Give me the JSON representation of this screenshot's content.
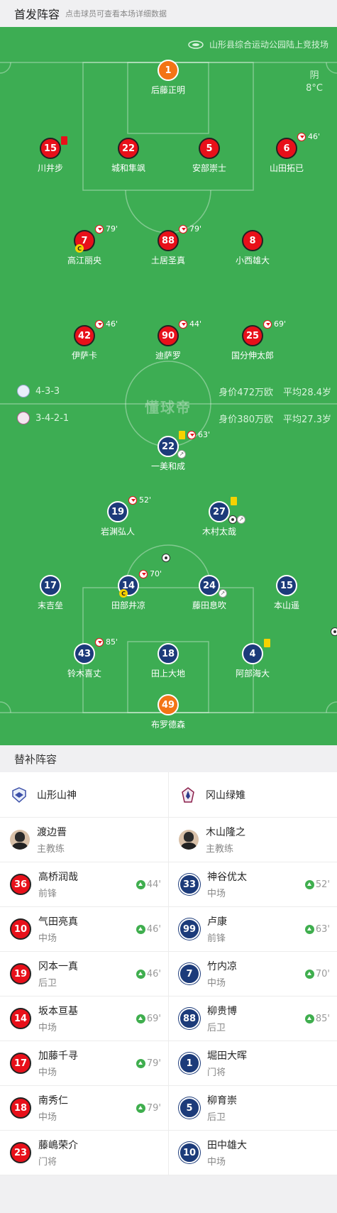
{
  "header": {
    "title": "首发阵容",
    "subtitle": "点击球员可查看本场详细数据"
  },
  "venue": {
    "name": "山形县综合运动公园陆上竞技场"
  },
  "weather": {
    "condition": "阴",
    "temperature": "8°C"
  },
  "home": {
    "formation": "4-3-3",
    "value": "身价472万欧",
    "avg_age": "平均28.4岁",
    "players": [
      {
        "number": "1",
        "name": "后藤正明"
      },
      {
        "number": "15",
        "name": "川井步"
      },
      {
        "number": "22",
        "name": "城和隼飒"
      },
      {
        "number": "5",
        "name": "安部崇士"
      },
      {
        "number": "6",
        "name": "山田拓已",
        "sub_minute": "46'"
      },
      {
        "number": "7",
        "name": "高江丽央",
        "sub_minute": "79'"
      },
      {
        "number": "88",
        "name": "土居圣真",
        "sub_minute": "79'"
      },
      {
        "number": "8",
        "name": "小西雄大"
      },
      {
        "number": "42",
        "name": "伊萨卡",
        "sub_minute": "46'"
      },
      {
        "number": "90",
        "name": "迪萨罗",
        "sub_minute": "44'"
      },
      {
        "number": "25",
        "name": "国分伸太郎",
        "sub_minute": "69'"
      }
    ]
  },
  "away": {
    "formation": "3-4-2-1",
    "value": "身价380万欧",
    "avg_age": "平均27.3岁",
    "players": [
      {
        "number": "22",
        "name": "一美和成",
        "sub_minute": "63'"
      },
      {
        "number": "19",
        "name": "岩渊弘人",
        "sub_minute": "52'"
      },
      {
        "number": "27",
        "name": "木村太哉"
      },
      {
        "number": "17",
        "name": "末吉垒"
      },
      {
        "number": "14",
        "name": "田部井凉",
        "sub_minute": "70'"
      },
      {
        "number": "24",
        "name": "藤田息吹"
      },
      {
        "number": "15",
        "name": "本山遥"
      },
      {
        "number": "43",
        "name": "铃木喜丈",
        "sub_minute": "85'"
      },
      {
        "number": "18",
        "name": "田上大地"
      },
      {
        "number": "4",
        "name": "阿部海大"
      },
      {
        "number": "49",
        "name": "布罗德森"
      }
    ]
  },
  "watermark": "懂球帝",
  "subs_title": "替补阵容",
  "subs": {
    "home_team": "山形山神",
    "away_team": "冈山绿雉",
    "home_coach": {
      "name": "渡边晋",
      "role": "主教练"
    },
    "away_coach": {
      "name": "木山隆之",
      "role": "主教练"
    },
    "home_list": [
      {
        "number": "36",
        "name": "高桥润哉",
        "pos": "前锋",
        "minute": "44'"
      },
      {
        "number": "10",
        "name": "气田亮真",
        "pos": "中场",
        "minute": "46'"
      },
      {
        "number": "19",
        "name": "冈本一真",
        "pos": "后卫",
        "minute": "46'"
      },
      {
        "number": "14",
        "name": "坂本亘基",
        "pos": "中场",
        "minute": "69'"
      },
      {
        "number": "17",
        "name": "加藤千寻",
        "pos": "中场",
        "minute": "79'"
      },
      {
        "number": "18",
        "name": "南秀仁",
        "pos": "中场",
        "minute": "79'"
      },
      {
        "number": "23",
        "name": "藤嶋荣介",
        "pos": "门将",
        "minute": ""
      }
    ],
    "away_list": [
      {
        "number": "33",
        "name": "神谷优太",
        "pos": "中场",
        "minute": "52'"
      },
      {
        "number": "99",
        "name": "卢康",
        "pos": "前锋",
        "minute": "63'"
      },
      {
        "number": "7",
        "name": "竹内凉",
        "pos": "中场",
        "minute": "70'"
      },
      {
        "number": "88",
        "name": "柳贵博",
        "pos": "后卫",
        "minute": "85'"
      },
      {
        "number": "1",
        "name": "堀田大晖",
        "pos": "门将",
        "minute": ""
      },
      {
        "number": "5",
        "name": "柳育崇",
        "pos": "后卫",
        "minute": ""
      },
      {
        "number": "10",
        "name": "田中雄大",
        "pos": "中场",
        "minute": ""
      }
    ]
  },
  "colors": {
    "pitch": "#3dad53",
    "home": "#e8101a",
    "away": "#1c3b7a",
    "keeper": "#f37415",
    "sub_in": "#3fae4e"
  }
}
